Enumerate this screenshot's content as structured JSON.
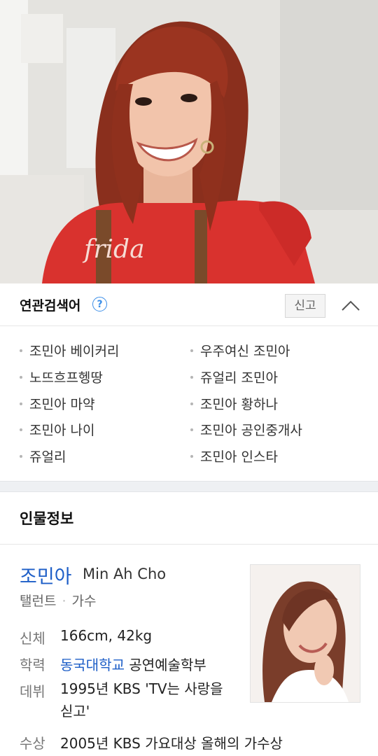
{
  "related": {
    "title": "연관검색어",
    "report_label": "신고",
    "left": [
      "조민아 베이커리",
      "노뜨흐프헹땅",
      "조민아 마약",
      "조민아 나이",
      "쥬얼리"
    ],
    "right": [
      "우주여신 조민아",
      "쥬얼리 조민아",
      "조민아 황하나",
      "조민아 공인중개사",
      "조민아 인스타"
    ]
  },
  "person": {
    "section_title": "인물정보",
    "name_ko": "조민아",
    "name_en": "Min Ah Cho",
    "occupation": [
      "탤런트",
      "가수"
    ],
    "info": {
      "body_label": "신체",
      "body_value": "166cm, 42kg",
      "edu_label": "학력",
      "edu_link": "동국대학교",
      "edu_rest": " 공연예술학부",
      "debut_label": "데뷔",
      "debut_line1": "1995년 KBS 'TV는 사랑을",
      "debut_line2": "싣고'",
      "award_label": "수상",
      "award_value": "2005년 KBS 가요대상 올해의 가수상"
    }
  },
  "colors": {
    "accent": "#1d5ec7",
    "help": "#3b8ee8"
  },
  "icons": {
    "help": "question-circle-icon",
    "collapse": "chevron-up-icon"
  }
}
